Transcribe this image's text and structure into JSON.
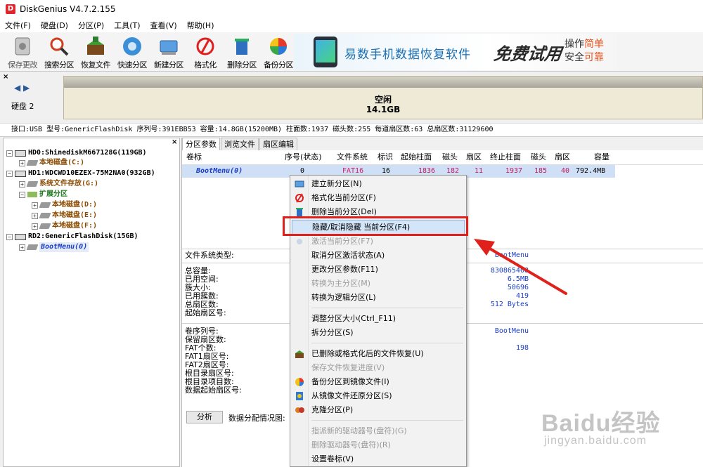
{
  "window": {
    "title": "DiskGenius V4.7.2.155",
    "icon_letter": "D"
  },
  "menu": [
    "文件(F)",
    "硬盘(D)",
    "分区(P)",
    "工具(T)",
    "查看(V)",
    "帮助(H)"
  ],
  "toolbar": [
    {
      "label": "保存更改",
      "icon": "save-icon"
    },
    {
      "label": "搜索分区",
      "icon": "search-icon"
    },
    {
      "label": "恢复文件",
      "icon": "recover-icon"
    },
    {
      "label": "快速分区",
      "icon": "quick-partition-icon"
    },
    {
      "label": "新建分区",
      "icon": "new-partition-icon"
    },
    {
      "label": "格式化",
      "icon": "format-icon"
    },
    {
      "label": "删除分区",
      "icon": "delete-icon"
    },
    {
      "label": "备份分区",
      "icon": "backup-icon"
    }
  ],
  "ad": {
    "text": "易数手机数据恢复软件",
    "free": "免费试用",
    "side1": "操作",
    "side1_hl": "简单",
    "side2": "安全",
    "side2_hl": "可靠"
  },
  "disk": {
    "label": "硬盘 2",
    "free_label": "空闲",
    "free_size": "14.1GB"
  },
  "disk_info": "接口:USB  型号:GenericFlashDisk  序列号:391EBB53  容量:14.8GB(15200MB)  柱面数:1937  磁头数:255  每道扇区数:63  总扇区数:31129600",
  "tree": [
    {
      "type": "disk",
      "text": "HD0:ShinediskM667128G(119GB)"
    },
    {
      "type": "part",
      "text": "本地磁盘(C:)"
    },
    {
      "type": "disk",
      "text": "HD1:WDCWD10EZEX-75M2NA0(932GB)"
    },
    {
      "type": "part",
      "text": "系统文件存放(G:)"
    },
    {
      "type": "ext",
      "text": "扩展分区"
    },
    {
      "type": "part",
      "text": "本地磁盘(D:)"
    },
    {
      "type": "part",
      "text": "本地磁盘(E:)"
    },
    {
      "type": "part",
      "text": "本地磁盘(F:)"
    },
    {
      "type": "disk",
      "text": "RD2:GenericFlashDisk(15GB)"
    },
    {
      "type": "sel",
      "text": "BootMenu(0)"
    }
  ],
  "tabs": [
    "分区参数",
    "浏览文件",
    "扇区编辑"
  ],
  "table": {
    "headers": [
      "卷标",
      "序号(状态)",
      "文件系统",
      "标识",
      "起始柱面",
      "磁头",
      "扇区",
      "终止柱面",
      "磁头",
      "扇区",
      "容量"
    ],
    "row": [
      "BootMenu(0)",
      "0",
      "FAT16",
      "16",
      "1836",
      "182",
      "11",
      "1937",
      "185",
      "40",
      "792.4MB"
    ]
  },
  "fs_info": {
    "type_label": "文件系统类型:",
    "type_value": "BootMenu",
    "labels1": [
      "总容量:",
      "已用空间:",
      "簇大小:",
      "已用簇数:",
      "总扇区数:",
      "起始扇区号:"
    ],
    "values1": [
      "830865408",
      "6.5MB",
      "50696",
      "419",
      "512 Bytes",
      ""
    ],
    "labels2": [
      "卷序列号:",
      "保留扇区数:",
      "FAT个数:",
      "FAT1扇区号:",
      "FAT2扇区号:",
      "根目录扇区号:",
      "根目录项目数:",
      "数据起始扇区号:"
    ],
    "values2": [
      "BootMenu",
      "",
      "198",
      "",
      "",
      "",
      "",
      ""
    ]
  },
  "analyze": {
    "button": "分析",
    "label": "数据分配情况图:"
  },
  "context_menu": [
    {
      "text": "建立新分区(N)",
      "disabled": false,
      "icon": "new-partition-icon"
    },
    {
      "text": "格式化当前分区(F)",
      "disabled": false,
      "icon": "format-icon"
    },
    {
      "text": "删除当前分区(Del)",
      "disabled": false,
      "icon": "delete-icon"
    },
    {
      "text": "隐藏/取消隐藏 当前分区(F4)",
      "disabled": false,
      "hover": true
    },
    {
      "text": "激活当前分区(F7)",
      "disabled": true,
      "icon": "activate-icon"
    },
    {
      "text": "取消分区激活状态(A)",
      "disabled": false
    },
    {
      "text": "更改分区参数(F11)",
      "disabled": false
    },
    {
      "text": "转换为主分区(M)",
      "disabled": true
    },
    {
      "text": "转换为逻辑分区(L)",
      "disabled": false
    },
    {
      "text": "调整分区大小(Ctrl_F11)",
      "disabled": false
    },
    {
      "text": "拆分分区(S)",
      "disabled": false
    },
    {
      "text": "已删除或格式化后的文件恢复(U)",
      "disabled": false,
      "icon": "recover-icon"
    },
    {
      "text": "保存文件恢复进度(V)",
      "disabled": true
    },
    {
      "text": "备份分区到镜像文件(I)",
      "disabled": false,
      "icon": "backup-icon"
    },
    {
      "text": "从镜像文件还原分区(S)",
      "disabled": false,
      "icon": "restore-icon"
    },
    {
      "text": "克隆分区(P)",
      "disabled": false,
      "icon": "clone-icon"
    },
    {
      "text": "指派新的驱动器号(盘符)(G)",
      "disabled": true
    },
    {
      "text": "删除驱动器号(盘符)(R)",
      "disabled": true
    },
    {
      "text": "设置卷标(V)",
      "disabled": false
    }
  ],
  "watermark": {
    "main": "Baidu经验",
    "sub": "jingyan.baidu.com"
  },
  "colors": {
    "highlight": "#e0201a",
    "arrow": "#e0201a",
    "selection": "#cfe0f6"
  }
}
